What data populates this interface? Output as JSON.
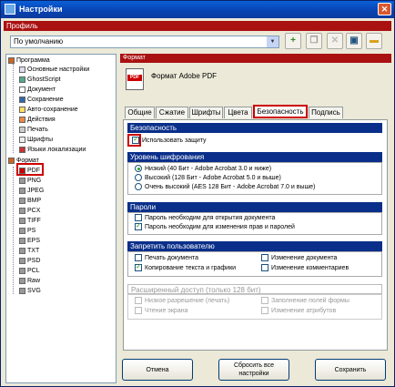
{
  "window": {
    "title": "Настройки",
    "close": "✕"
  },
  "profile": {
    "header": "Профиль",
    "selected": "По умолчанию",
    "toolbar_icons": [
      "add-icon",
      "copy-icon",
      "delete-icon",
      "save-icon",
      "folder-icon"
    ]
  },
  "tree": {
    "program": {
      "label": "Программа",
      "items": [
        "Основные настройки",
        "GhostScript",
        "Документ",
        "Сохранение",
        "Авто-сохранение",
        "Действия",
        "Печать",
        "Шрифты",
        "Языки локализации"
      ]
    },
    "format": {
      "label": "Формат",
      "items": [
        "PDF",
        "PNG",
        "JPEG",
        "BMP",
        "PCX",
        "TIFF",
        "PS",
        "EPS",
        "TXT",
        "PSD",
        "PCL",
        "Raw",
        "SVG"
      ]
    }
  },
  "format_panel": {
    "header": "Формат",
    "name": "Формат Adobe PDF",
    "icon_label": "PDF"
  },
  "tabs": [
    "Общие",
    "Сжатие",
    "Шрифты",
    "Цвета",
    "Безопасность",
    "Подпись"
  ],
  "security": {
    "header": "Безопасность",
    "use_protection": "Использовать защиту",
    "encryption": {
      "header": "Уровень шифрования",
      "options": [
        "Низкий (40 Бит - Adobe Acrobat 3.0 и ниже)",
        "Высокий (128 Бит - Adobe Acrobat 5.0 и выше)",
        "Очень высокий (AES 128 Бит - Adobe Acrobat 7.0 и выше)"
      ]
    },
    "passwords": {
      "header": "Пароли",
      "items": [
        "Пароль необходим для открытия документа",
        "Пароль необходим для изменения прав и паролей"
      ]
    },
    "restrict": {
      "header": "Запретить пользователю",
      "items": [
        "Печать документа",
        "Изменение документа",
        "Копирование текста и графики",
        "Изменение комментариев"
      ]
    },
    "extended": {
      "header": "Расширенный доступ (только 128 бит)",
      "items": [
        "Низкое разрешение (печать)",
        "Заполнение полей формы",
        "Чтение экрана",
        "Изменение атрибутов"
      ]
    }
  },
  "buttons": {
    "cancel": "Отмена",
    "reset": "Сбросить все настройки",
    "save": "Сохранить"
  }
}
